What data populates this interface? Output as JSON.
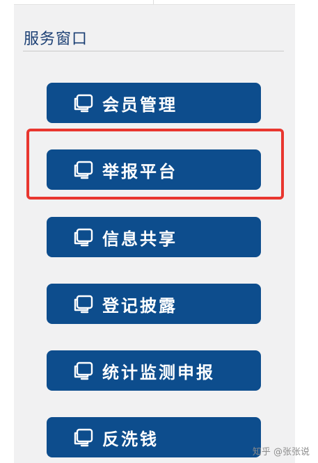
{
  "section": {
    "title": "服务窗口"
  },
  "menu": {
    "items": [
      {
        "label": "会员管理",
        "icon": "monitor-icon"
      },
      {
        "label": "举报平台",
        "icon": "monitor-icon",
        "highlighted": true
      },
      {
        "label": "信息共享",
        "icon": "monitor-icon"
      },
      {
        "label": "登记披露",
        "icon": "monitor-icon"
      },
      {
        "label": "统计监测申报",
        "icon": "monitor-icon"
      },
      {
        "label": "反洗钱",
        "icon": "monitor-icon"
      }
    ]
  },
  "colors": {
    "button_bg": "#0d4d8d",
    "title": "#1b3f74",
    "highlight": "#e8362f",
    "panel_bg": "#f1f1f2"
  },
  "watermark": {
    "text": "知乎 @张张说"
  }
}
